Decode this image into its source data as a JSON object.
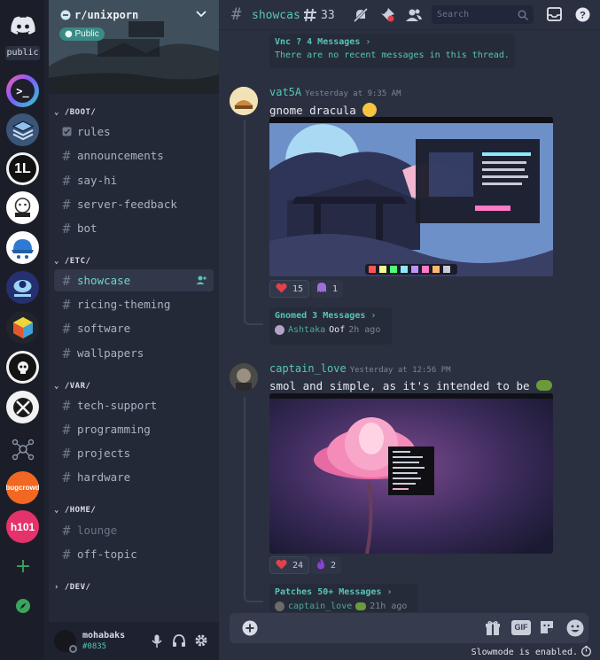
{
  "rail": {
    "public_label": "public",
    "servers": [
      {
        "name": "terminal-server-icon",
        "color": "#7f5bff"
      },
      {
        "name": "layers-server-icon",
        "color": "#4f7fb8"
      },
      {
        "name": "tl-server-icon",
        "color": "#f1f1f1"
      },
      {
        "name": "doodle-server-icon",
        "color": "#ffffff"
      },
      {
        "name": "hat-server-icon",
        "color": "#2f7bd3"
      },
      {
        "name": "team-server-icon",
        "color": "#2e3a7a"
      },
      {
        "name": "cube-server-icon",
        "color": "#22242b"
      },
      {
        "name": "skull-server-icon",
        "color": "#f2f2f2"
      },
      {
        "name": "no-server-icon",
        "color": "#f2f2f2"
      },
      {
        "name": "nodes-server-icon",
        "color": "#1b1e29"
      },
      {
        "name": "bugcrowd-server-icon",
        "color": "#f26822"
      },
      {
        "name": "h101-server-icon",
        "color": "#e5326b"
      }
    ],
    "bugcrowd_text": "bugcrowd",
    "h101_text": "h101"
  },
  "server": {
    "name": "r/unixporn",
    "badge": "Public"
  },
  "categories": [
    {
      "label": "/BOOT/",
      "channels": [
        {
          "label": "rules",
          "icon": "rules-checkbox-icon"
        },
        {
          "label": "announcements"
        },
        {
          "label": "say-hi"
        },
        {
          "label": "server-feedback"
        },
        {
          "label": "bot"
        }
      ]
    },
    {
      "label": "/ETC/",
      "channels": [
        {
          "label": "showcase",
          "active": true
        },
        {
          "label": "ricing-theming"
        },
        {
          "label": "software"
        },
        {
          "label": "wallpapers"
        }
      ]
    },
    {
      "label": "/VAR/",
      "channels": [
        {
          "label": "tech-support"
        },
        {
          "label": "programming"
        },
        {
          "label": "projects"
        },
        {
          "label": "hardware"
        }
      ]
    },
    {
      "label": "/HOME/",
      "channels": [
        {
          "label": "lounge",
          "muted": true
        },
        {
          "label": "off-topic"
        }
      ]
    },
    {
      "label": "/DEV/",
      "channels": []
    }
  ],
  "user": {
    "name": "mohabaks",
    "tag": "#0835"
  },
  "header": {
    "channel": "showcas",
    "threads_count": "33",
    "search_placeholder": "Search"
  },
  "messages": {
    "thread_top": {
      "title": "Vnc ?",
      "count": "4 Messages",
      "sub": "There are no recent messages in this thread."
    },
    "m1": {
      "author": "vat5A",
      "timestamp": "Yesterday at 9:35 AM",
      "text": "gnome dracula",
      "reactions": [
        {
          "emoji": "heart-emoji-icon",
          "count": "15"
        },
        {
          "emoji": "ghost-emoji-icon",
          "count": "1"
        }
      ],
      "thread": {
        "title": "Gnomed",
        "count": "3 Messages",
        "last_author": "Ashtaka",
        "last_text": "Oof",
        "last_time": "2h ago"
      }
    },
    "m2": {
      "author": "captain_love",
      "timestamp": "Yesterday at 12:56 PM",
      "text": "smol and simple, as it's intended to be",
      "reactions": [
        {
          "emoji": "heart-emoji-icon",
          "count": "24"
        },
        {
          "emoji": "flame-emoji-icon",
          "count": "2"
        }
      ],
      "thread": {
        "title": "Patches",
        "count": "50+ Messages",
        "last_author": "captain_love",
        "last_time": "21h ago"
      }
    }
  },
  "composer": {
    "gif_label": "GIF"
  },
  "slowmode": "Slowmode is enabled."
}
